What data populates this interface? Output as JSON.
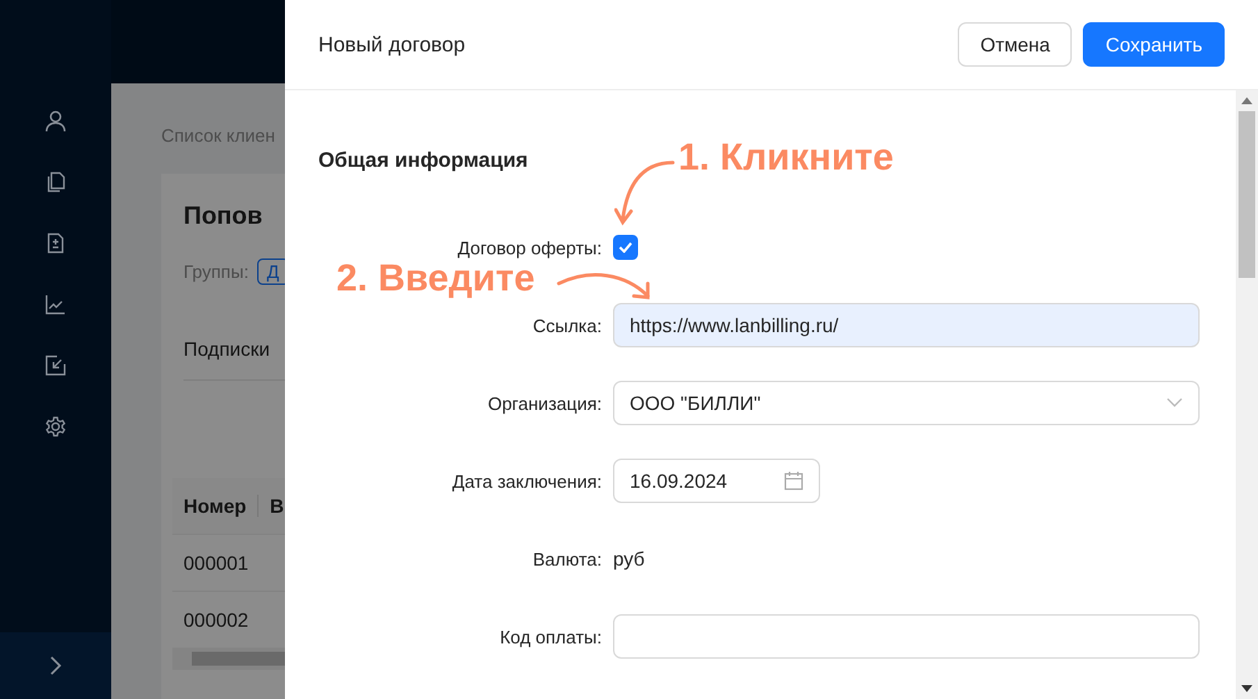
{
  "background_page": {
    "breadcrumb": "Список клиен",
    "client_name": "Попов",
    "groups_label": "Группы:",
    "group_tag": "Д",
    "tab": "Подписки",
    "table": {
      "columns": [
        "Номер",
        "В"
      ],
      "rows": [
        [
          "000001"
        ],
        [
          "000002"
        ]
      ]
    }
  },
  "drawer": {
    "title": "Новый договор",
    "buttons": [
      {
        "label": "Отмена",
        "kind": "secondary"
      },
      {
        "label": "Сохранить",
        "kind": "primary"
      }
    ],
    "section_title": "Общая информация",
    "fields": [
      {
        "kind": "checkbox",
        "label": "Договор оферты:",
        "checked": true
      },
      {
        "kind": "text",
        "label": "Ссылка:",
        "value": "https://www.lanbilling.ru/",
        "highlighted": true
      },
      {
        "kind": "select",
        "label": "Организация:",
        "value": "ООО \"БИЛЛИ\""
      },
      {
        "kind": "date",
        "label": "Дата заключения:",
        "value": "16.09.2024"
      },
      {
        "kind": "static",
        "label": "Валюта:",
        "value": "руб"
      },
      {
        "kind": "text",
        "label": "Код оплаты:",
        "highlighted": false
      }
    ]
  },
  "annotations": [
    {
      "text": "1. Кликните"
    },
    {
      "text": "2. Введите"
    }
  ]
}
